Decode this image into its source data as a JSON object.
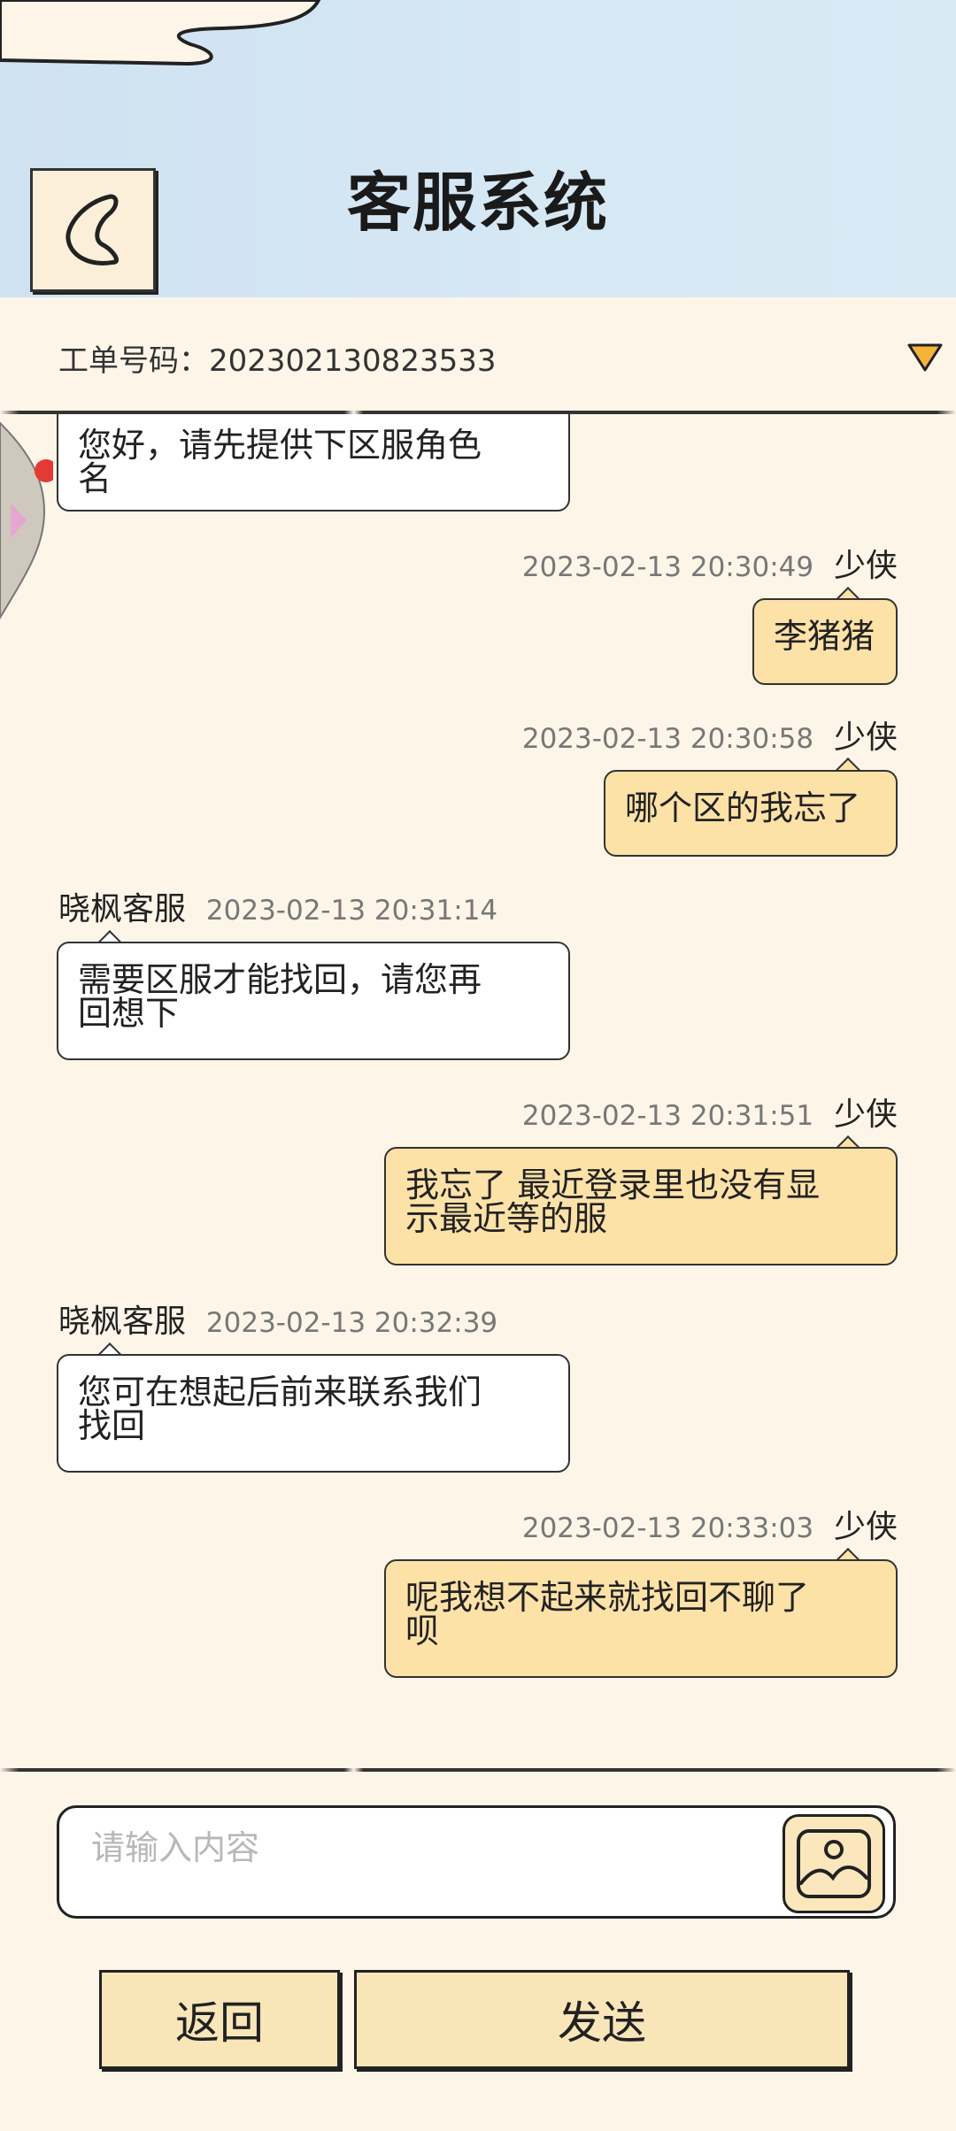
{
  "header": {
    "title": "客服系统",
    "back_icon": "heart-back-icon"
  },
  "ticket": {
    "label": "工单号码：202302130823533",
    "toggle_icon": "triangle-down-icon",
    "toggle_color": "#f4b43a"
  },
  "messages": [
    {
      "side": "left",
      "text_lines": [
        "您好，请先提供下区服角色",
        "名"
      ]
    },
    {
      "side": "right",
      "time": "2023-02-13 20:30:49",
      "name": "少侠",
      "text_lines": [
        "李猪猪"
      ]
    },
    {
      "side": "right",
      "time": "2023-02-13 20:30:58",
      "name": "少侠",
      "text_lines": [
        "哪个区的我忘了"
      ]
    },
    {
      "side": "left",
      "name": "晓枫客服",
      "time": "2023-02-13 20:31:14",
      "text_lines": [
        "需要区服才能找回，请您再",
        "回想下"
      ]
    },
    {
      "side": "right",
      "time": "2023-02-13 20:31:51",
      "name": "少侠",
      "text_lines": [
        "我忘了 最近登录里也没有显",
        "示最近等的服"
      ]
    },
    {
      "side": "left",
      "name": "晓枫客服",
      "time": "2023-02-13 20:32:39",
      "text_lines": [
        "您可在想起后前来联系我们",
        "找回"
      ]
    },
    {
      "side": "right",
      "time": "2023-02-13 20:33:03",
      "name": "少侠",
      "text_lines": [
        "呢我想不起来就找回不聊了",
        "呗"
      ]
    }
  ],
  "composer": {
    "placeholder": "请输入内容",
    "image_icon": "image-icon"
  },
  "buttons": {
    "back_label": "返回",
    "send_label": "发送"
  },
  "colors": {
    "header_bg": "#d6e8f4",
    "page_bg": "#fdf5e8",
    "user_bubble": "#fde2a8",
    "accent_dot": "#e53935"
  }
}
